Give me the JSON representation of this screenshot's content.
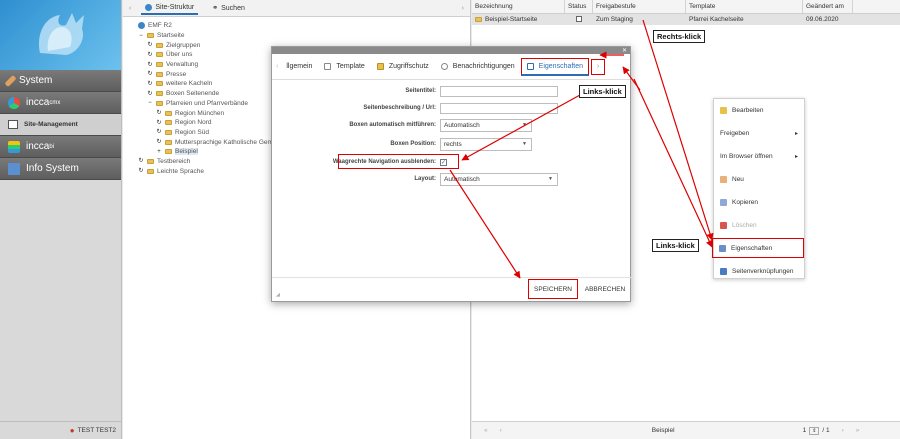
{
  "sidebar": {
    "items": [
      {
        "label": "System",
        "icon": "wrench-icon"
      },
      {
        "label": "incca",
        "sup": "cmx",
        "icon": "cubes-icon"
      },
      {
        "label": "Site-Management",
        "icon": "site-icon"
      },
      {
        "label": "incca",
        "sup": "bi",
        "icon": "stack-icon"
      },
      {
        "label": "Info System",
        "icon": "info-icon"
      }
    ],
    "user": "TEST TEST2"
  },
  "tree_tabs": {
    "site": "Site-Struktur",
    "search": "Suchen"
  },
  "tree": [
    {
      "label": "EMF R2",
      "level": 0,
      "toggle": "",
      "type": "globe"
    },
    {
      "label": "Startseite",
      "level": 1,
      "toggle": "−",
      "type": "folder"
    },
    {
      "label": "Zielgruppen",
      "level": 2,
      "toggle": "↻",
      "type": "folder"
    },
    {
      "label": "Über uns",
      "level": 2,
      "toggle": "↻",
      "type": "folder"
    },
    {
      "label": "Verwaltung",
      "level": 2,
      "toggle": "↻",
      "type": "folder"
    },
    {
      "label": "Presse",
      "level": 2,
      "toggle": "↻",
      "type": "folder"
    },
    {
      "label": "weitere Kacheln",
      "level": 2,
      "toggle": "↻",
      "type": "folder"
    },
    {
      "label": "Boxen Seitenende",
      "level": 2,
      "toggle": "↻",
      "type": "folder"
    },
    {
      "label": "Pfarreien und Pfarrverbände",
      "level": 2,
      "toggle": "−",
      "type": "folder"
    },
    {
      "label": "Region München",
      "level": 3,
      "toggle": "↻",
      "type": "folder"
    },
    {
      "label": "Region Nord",
      "level": 3,
      "toggle": "↻",
      "type": "folder"
    },
    {
      "label": "Region Süd",
      "level": 3,
      "toggle": "↻",
      "type": "folder"
    },
    {
      "label": "Muttersprachige Katholische Gem",
      "level": 3,
      "toggle": "↻",
      "type": "folder"
    },
    {
      "label": "Beispiel",
      "level": 3,
      "toggle": "+",
      "type": "folder",
      "selected": true
    },
    {
      "label": "Testbereich",
      "level": 1,
      "toggle": "↻",
      "type": "folder"
    },
    {
      "label": "Leichte Sprache",
      "level": 1,
      "toggle": "↻",
      "type": "folder"
    }
  ],
  "list": {
    "columns": [
      "Bezeichnung",
      "Status",
      "Freigabestufe",
      "Template",
      "Geändert am"
    ],
    "row": [
      "Beispiel-Startseite",
      "",
      "Zum Staging",
      "Pfarrei Kachelseite",
      "09.06.2020"
    ],
    "footer_label": "Beispiel",
    "page_current": "1",
    "page_total": "/ 1"
  },
  "dialog": {
    "tabs": [
      "llgemein",
      "Template",
      "Zugriffschutz",
      "Benachrichtigungen",
      "Eigenschaften"
    ],
    "fields": {
      "title_label": "Seitentitel:",
      "desc_label": "Seitenbeschreibung / Url:",
      "boxes_label": "Boxen automatisch mitführen:",
      "boxes_value": "Automatisch",
      "boxpos_label": "Boxen Position:",
      "boxpos_value": "rechts",
      "nav_label": "Waagrechte Navigation ausblenden:",
      "layout_label": "Layout:",
      "layout_value": "Automatisch"
    },
    "save": "SPEICHERN",
    "cancel": "ABBRECHEN"
  },
  "context_menu": [
    {
      "label": "Bearbeiten",
      "icon": "edit-icon",
      "arrow": false
    },
    {
      "label": "Freigeben",
      "icon": "",
      "arrow": true
    },
    {
      "label": "Im Browser öffnen",
      "icon": "",
      "arrow": true
    },
    {
      "label": "Neu",
      "icon": "new-icon",
      "arrow": false
    },
    {
      "label": "Kopieren",
      "icon": "copy-icon",
      "arrow": false
    },
    {
      "label": "Löschen",
      "icon": "delete-icon",
      "arrow": false,
      "disabled": true
    },
    {
      "label": "Eigenschaften",
      "icon": "properties-icon",
      "arrow": false,
      "highlight": true
    },
    {
      "label": "Seitenverknüpfungen",
      "icon": "links-icon",
      "arrow": false
    }
  ],
  "callouts": {
    "right_click": "Rechts-klick",
    "left_click_1": "Links-klick",
    "left_click_2": "Links-klick"
  },
  "colors": {
    "accent": "#2c6db5",
    "annotation": "#dd0000"
  }
}
